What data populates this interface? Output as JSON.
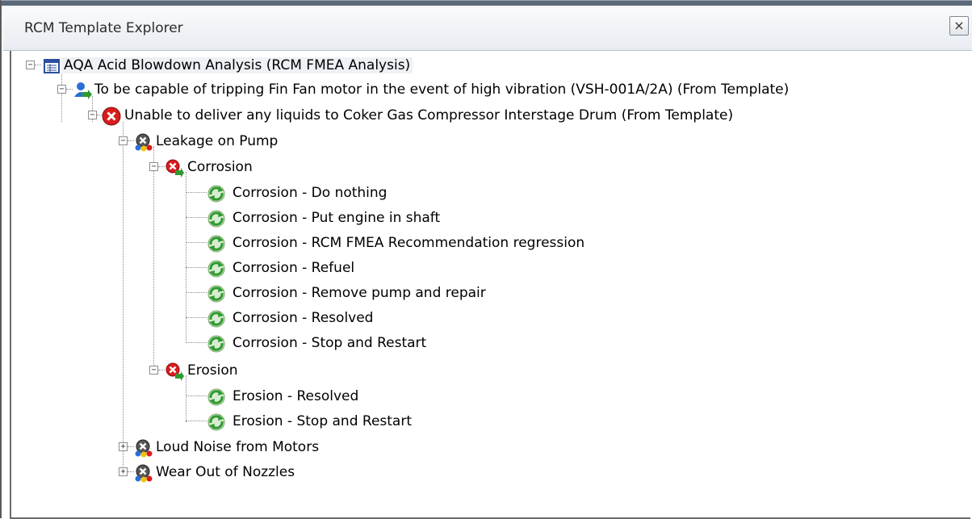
{
  "window": {
    "title": "RCM Template Explorer",
    "close_glyph": "×"
  },
  "tree": {
    "root": "AQA Acid Blowdown Analysis (RCM FMEA Analysis)",
    "function": "To be capable of tripping Fin Fan motor in the event of high vibration (VSH-001A/2A) (From Template)",
    "functional_failure": "Unable to deliver any liquids to Coker Gas Compressor Interstage Drum (From Template)",
    "failure_modes": [
      {
        "label": "Leakage on Pump"
      },
      {
        "label": "Loud Noise from Motors"
      },
      {
        "label": "Wear Out of Nozzles"
      }
    ],
    "causes": [
      {
        "label": "Corrosion"
      },
      {
        "label": "Erosion"
      }
    ],
    "corrosion_actions": [
      "Corrosion - Do nothing",
      "Corrosion - Put engine in shaft",
      "Corrosion - RCM FMEA Recommendation regression",
      "Corrosion - Refuel",
      "Corrosion - Remove pump and repair",
      "Corrosion - Resolved",
      "Corrosion - Stop and Restart"
    ],
    "erosion_actions": [
      "Erosion - Resolved",
      "Erosion - Stop and Restart"
    ]
  },
  "icons": {
    "analysis": "table-doc-icon",
    "function": "blue-person-arrow-icon",
    "functional_failure": "red-x-circle-icon",
    "failure_mode": "gray-x-dots-icon",
    "cause": "red-x-arrow-icon",
    "action": "green-refresh-icon"
  },
  "colors": {
    "error_red": "#d91c1c",
    "action_green": "#2f9a2f",
    "function_blue": "#2a6fd6"
  }
}
